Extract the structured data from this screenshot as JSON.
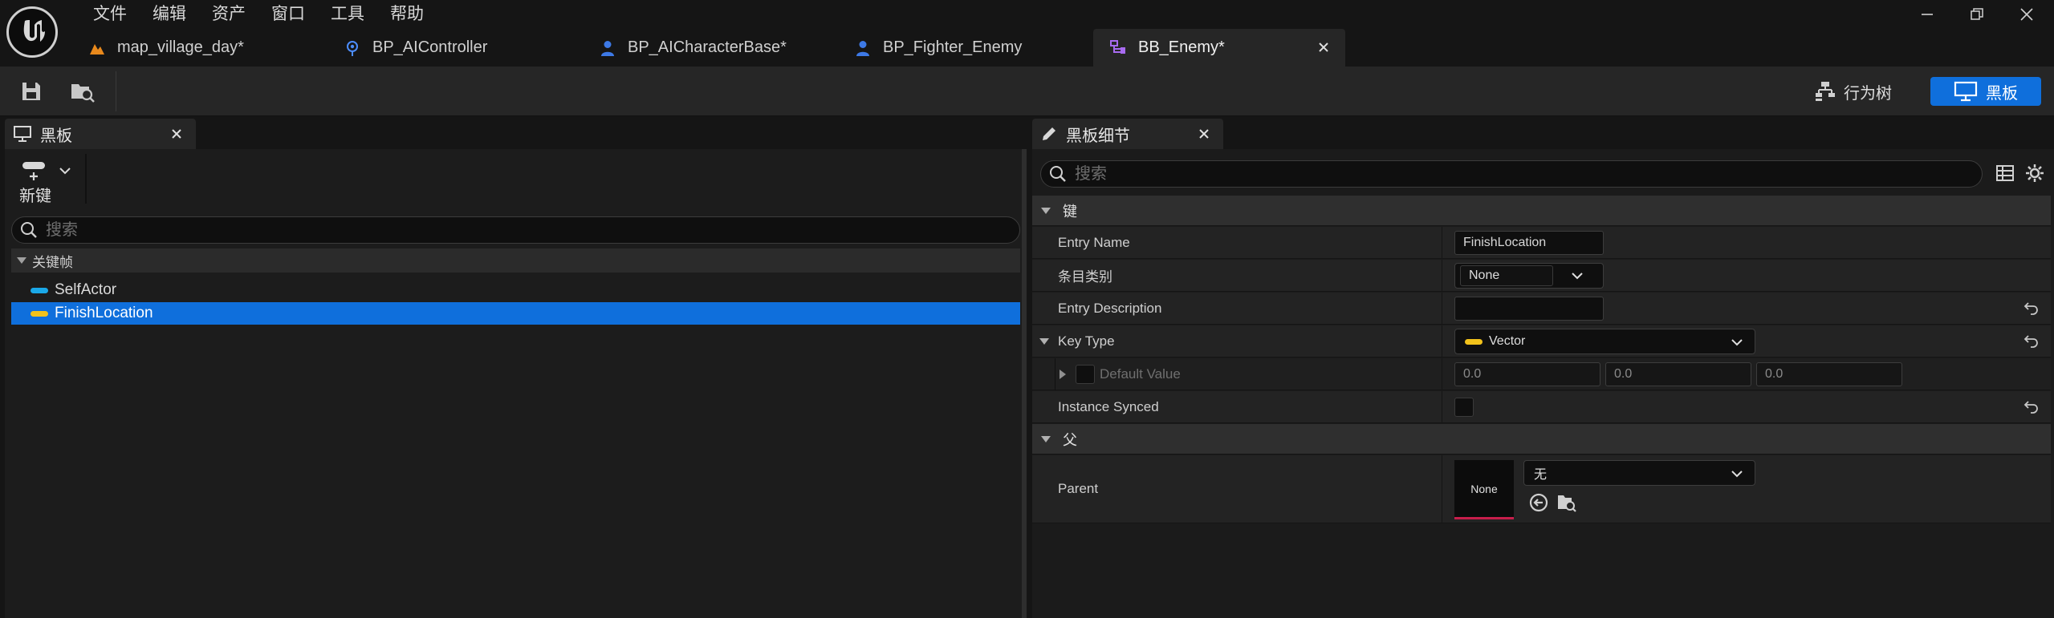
{
  "menu": [
    "文件",
    "编辑",
    "资产",
    "窗口",
    "工具",
    "帮助"
  ],
  "tabs": [
    {
      "label": "map_village_day*"
    },
    {
      "label": "BP_AIController"
    },
    {
      "label": "BP_AICharacterBase*"
    },
    {
      "label": "BP_Fighter_Enemy"
    },
    {
      "label": "BB_Enemy*"
    }
  ],
  "toolbar": {
    "behavior_tree_label": "行为树",
    "blackboard_label": "黑板"
  },
  "left_panel": {
    "title": "黑板",
    "new_key_label": "新键",
    "search_placeholder": "搜索",
    "category": "关键帧",
    "keys": [
      {
        "name": "SelfActor",
        "color": "#1aa8e8"
      },
      {
        "name": "FinishLocation",
        "color": "#f2c21b"
      }
    ]
  },
  "right_panel": {
    "title": "黑板细节",
    "search_placeholder": "搜索",
    "section_key": "键",
    "entry_name_label": "Entry Name",
    "entry_name_value": "FinishLocation",
    "entry_category_label": "条目类别",
    "entry_category_value": "None",
    "entry_description_label": "Entry Description",
    "entry_description_value": "",
    "key_type_label": "Key Type",
    "key_type_value": "Vector",
    "key_type_color": "#f2c21b",
    "default_value_label": "Default Value",
    "default_values": [
      "0.0",
      "0.0",
      "0.0"
    ],
    "instance_synced_label": "Instance Synced",
    "section_parent": "父",
    "parent_label": "Parent",
    "parent_thumb": "None",
    "parent_value": "无"
  },
  "colors": {
    "accent": "#0f6fdc",
    "vector": "#f2c21b",
    "object": "#1aa8e8"
  }
}
